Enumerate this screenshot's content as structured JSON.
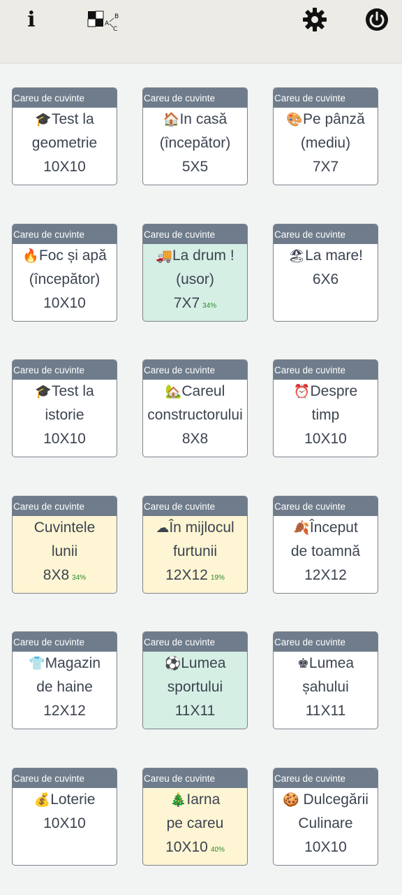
{
  "topbar": {
    "info_icon": "info-icon",
    "logo_icon": "crossword-logo-icon",
    "settings_icon": "gear-icon",
    "power_icon": "power-icon"
  },
  "colors": {
    "header": "#6f7c8b",
    "card_white": "#ffffff",
    "card_green": "#d5efe4",
    "card_yellow": "#fdf5d3",
    "progress_text": "#2c8a2c"
  },
  "cards": [
    {
      "header": "Careu de cuvinte",
      "emoji": "🎓",
      "lines": [
        "Test la",
        "geometrie"
      ],
      "size": "10X10",
      "progress": "",
      "state": "white"
    },
    {
      "header": "Careu de cuvinte",
      "emoji": "🏠",
      "lines": [
        "In casă",
        "(începător)"
      ],
      "size": "5X5",
      "progress": "",
      "state": "white"
    },
    {
      "header": "Careu de cuvinte",
      "emoji": "🎨",
      "lines": [
        "Pe pânză",
        "(mediu)"
      ],
      "size": "7X7",
      "progress": "",
      "state": "white"
    },
    {
      "header": "Careu de cuvinte",
      "emoji": "🔥",
      "lines": [
        "Foc și apă",
        "(începător)"
      ],
      "size": "10X10",
      "progress": "",
      "state": "white"
    },
    {
      "header": "Careu de cuvinte",
      "emoji": "🚚",
      "lines": [
        "La drum !",
        "(usor)"
      ],
      "size": "7X7",
      "progress": "34%",
      "state": "green"
    },
    {
      "header": "Careu de cuvinte",
      "emoji": "🏖",
      "lines": [
        "La mare!"
      ],
      "size": "6X6",
      "progress": "",
      "state": "white"
    },
    {
      "header": "Careu de cuvinte",
      "emoji": "🎓",
      "lines": [
        "Test la",
        "istorie"
      ],
      "size": "10X10",
      "progress": "",
      "state": "white"
    },
    {
      "header": "Careu de cuvinte",
      "emoji": "🏡",
      "lines": [
        "Careul",
        "constructorului"
      ],
      "size": "8X8",
      "progress": "",
      "state": "white"
    },
    {
      "header": "Careu de cuvinte",
      "emoji": "⏰",
      "lines": [
        "Despre",
        "timp"
      ],
      "size": "10X10",
      "progress": "",
      "state": "white"
    },
    {
      "header": "Careu de cuvinte",
      "emoji": "",
      "lines": [
        "Cuvintele",
        "lunii"
      ],
      "size": "8X8",
      "progress": "34%",
      "state": "yellow"
    },
    {
      "header": "Careu de cuvinte",
      "emoji": "☁",
      "lines": [
        "În mijlocul",
        "furtunii"
      ],
      "size": "12X12",
      "progress": "19%",
      "state": "yellow"
    },
    {
      "header": "Careu de cuvinte",
      "emoji": "🍂",
      "lines": [
        "Început",
        "de toamnă"
      ],
      "size": "12X12",
      "progress": "",
      "state": "white"
    },
    {
      "header": "Careu de cuvinte",
      "emoji": "👕",
      "lines": [
        "Magazin",
        "de haine"
      ],
      "size": "12X12",
      "progress": "",
      "state": "white"
    },
    {
      "header": "Careu de cuvinte",
      "emoji": "⚽",
      "lines": [
        "Lumea",
        "sportului"
      ],
      "size": "11X11",
      "progress": "",
      "state": "green"
    },
    {
      "header": "Careu de cuvinte",
      "emoji": "♚",
      "lines": [
        "Lumea",
        "șahului"
      ],
      "size": "11X11",
      "progress": "",
      "state": "white"
    },
    {
      "header": "Careu de cuvinte",
      "emoji": "💰",
      "lines": [
        "Loterie"
      ],
      "size": "10X10",
      "progress": "",
      "state": "white"
    },
    {
      "header": "Careu de cuvinte",
      "emoji": "🎄",
      "lines": [
        "Iarna",
        "pe careu"
      ],
      "size": "10X10",
      "progress": "40%",
      "state": "yellow"
    },
    {
      "header": "Careu de cuvinte",
      "emoji": "🍪",
      "lines": [
        " Dulcegării",
        "Culinare"
      ],
      "size": "10X10",
      "progress": "",
      "state": "white"
    }
  ]
}
